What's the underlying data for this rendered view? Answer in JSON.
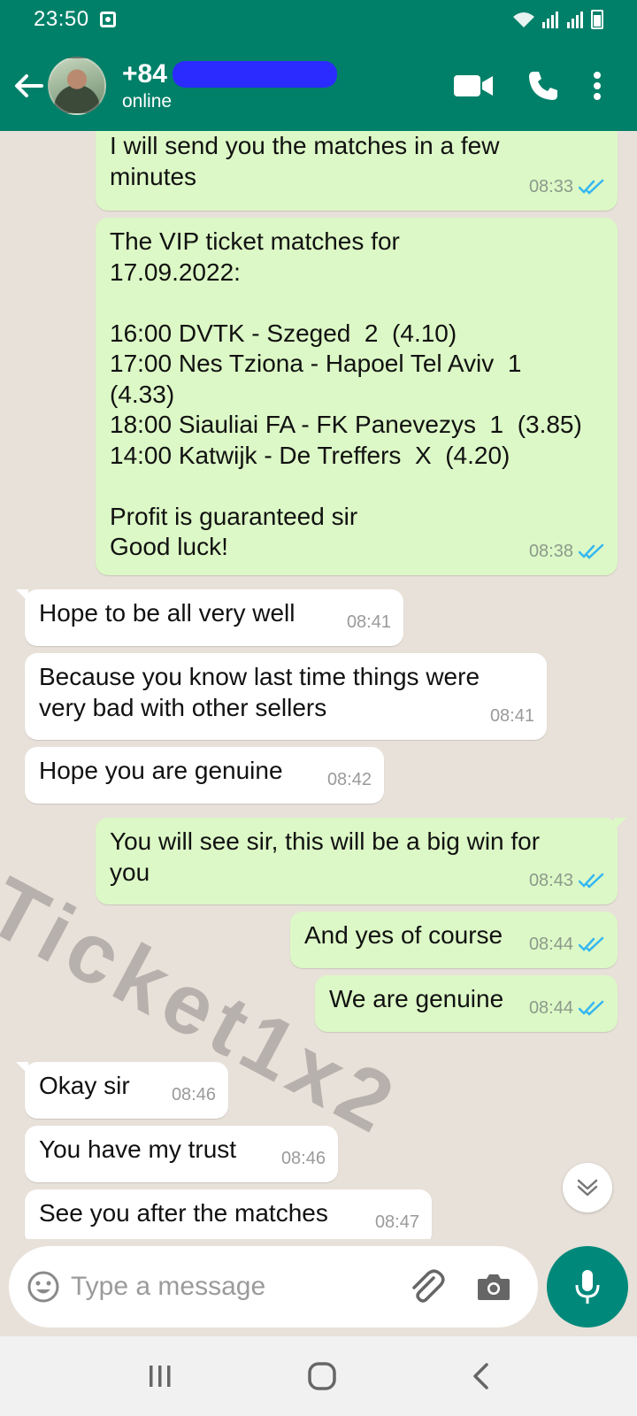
{
  "status_bar": {
    "time": "23:50"
  },
  "header": {
    "contact_name": "+84",
    "contact_status": "online"
  },
  "messages": [
    {
      "direction": "out",
      "text": "I will send you the matches in a few\nminutes",
      "time": "08:33"
    },
    {
      "direction": "out",
      "text": "The VIP ticket matches for\n17.09.2022:\n\n16:00 DVTK - Szeged  2  (4.10)\n17:00 Nes Tziona - Hapoel Tel Aviv  1\n(4.33)\n18:00 Siauliai FA - FK Panevezys  1  (3.85)\n14:00 Katwijk - De Treffers  X  (4.20)\n\nProfit is guaranteed sir\nGood luck!",
      "time": "08:38"
    },
    {
      "direction": "in",
      "text": "Hope to be all very well",
      "time": "08:41"
    },
    {
      "direction": "in",
      "text": "Because you know last time things were\nvery bad with other sellers",
      "time": "08:41"
    },
    {
      "direction": "in",
      "text": "Hope you are genuine",
      "time": "08:42"
    },
    {
      "direction": "out",
      "text": "You will see sir, this will be a big win for\nyou",
      "time": "08:43"
    },
    {
      "direction": "out",
      "text": "And yes of course",
      "time": "08:44"
    },
    {
      "direction": "out",
      "text": "We are genuine",
      "time": "08:44"
    },
    {
      "direction": "in",
      "text": "Okay sir",
      "time": "08:46"
    },
    {
      "direction": "in",
      "text": "You have my trust",
      "time": "08:46"
    },
    {
      "direction": "in",
      "text": "See you after the matches",
      "time": "08:47"
    }
  ],
  "watermark": "Ticket1x2",
  "composer": {
    "placeholder": "Type a message"
  },
  "colors": {
    "header": "#008069",
    "outgoing_bubble": "#dcf8c6",
    "incoming_bubble": "#ffffff",
    "read_tick": "#34b7f1",
    "mic_button": "#00897b"
  },
  "icons": {
    "back": "arrow-left-icon",
    "video": "video-camera-icon",
    "call": "phone-icon",
    "menu": "more-vertical-icon",
    "emoji": "emoji-icon",
    "attach": "paperclip-icon",
    "camera": "camera-icon",
    "mic": "microphone-icon",
    "scroll": "chevron-double-down-icon",
    "read": "double-check-icon"
  }
}
